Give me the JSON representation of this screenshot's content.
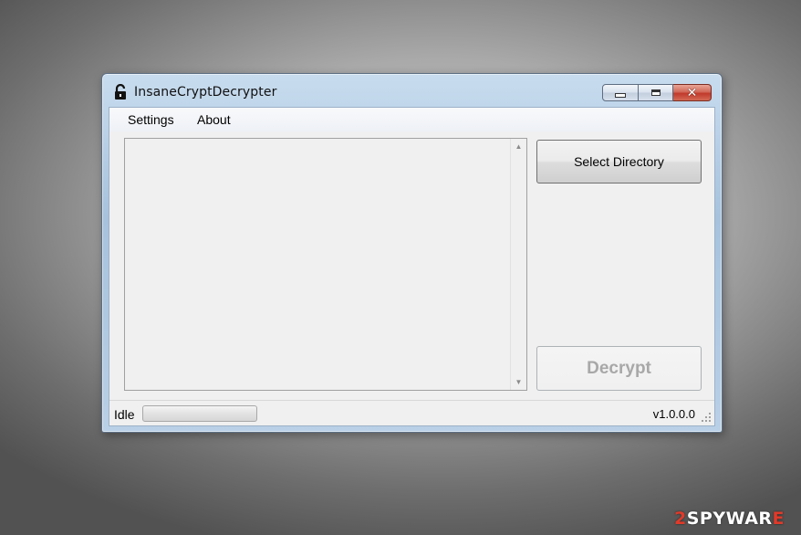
{
  "window": {
    "title": "InsaneCryptDecrypter",
    "icon": "unlock-icon",
    "caption_buttons": [
      "minimize-icon",
      "maximize-icon",
      "close-icon"
    ],
    "close_glyph": "✕"
  },
  "menu": {
    "items": [
      {
        "label": "Settings"
      },
      {
        "label": "About"
      }
    ]
  },
  "main": {
    "file_list_items": [],
    "select_directory_label": "Select Directory",
    "decrypt_label": "Decrypt",
    "decrypt_enabled": false
  },
  "status": {
    "text": "Idle",
    "progress_percent": 0,
    "version": "v1.0.0.0"
  },
  "watermark": {
    "prefix": "2",
    "text": "SPYWAR",
    "suffix": "E"
  },
  "colors": {
    "close_button": "#c0392b",
    "watermark_accent": "#e03a2a"
  }
}
